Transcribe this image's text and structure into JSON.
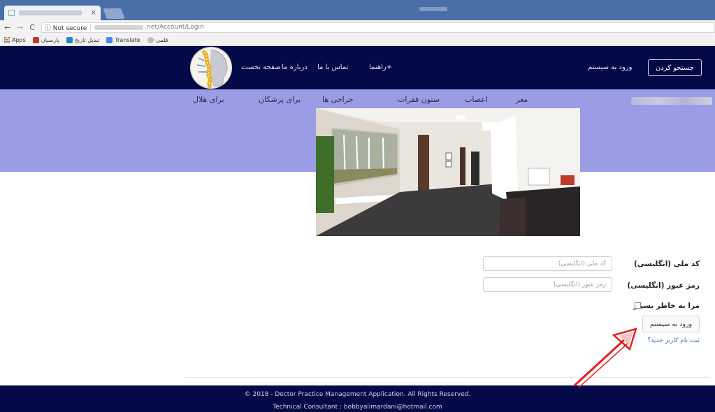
{
  "browser": {
    "tab_close": "×",
    "back_label": "←",
    "forward_label": "→",
    "reload_label": "C",
    "security_label": "ⓘ Not secure",
    "url_suffix": ".net/Account/Login",
    "bookmarks": [
      {
        "label": "Apps",
        "color": "#e0442f"
      },
      {
        "label": "پارسیان",
        "color": "#c0392b"
      },
      {
        "label": "تبدیل تاریخ",
        "color": "#1e88c8"
      },
      {
        "label": "Translate",
        "color": "#4a86e8"
      },
      {
        "label": "قلمی",
        "color": "#888888"
      }
    ]
  },
  "header": {
    "nav": {
      "home": "صفحه نخست",
      "about": "درباره ما",
      "contact": "تماس با ما",
      "help": "راهنما+"
    },
    "login_link": "ورود به سیستم",
    "search_button": "جستجو کردن",
    "bg_color": "#040a47"
  },
  "categories": {
    "brain": "مغز",
    "nerves": "اعصاب",
    "spine": "ستون فقرات",
    "surgery": "جراحی ها",
    "for_doctors": "برای پزشکان",
    "for_hilal": "برای هلال",
    "band_color": "#9b9ce6"
  },
  "form": {
    "national_code_label": "کد ملی (انگلیسی)",
    "national_code_placeholder": "کد ملی (انگلیسی)",
    "password_label": "رمز عبور (انگلیسی)",
    "password_placeholder": "رمز عبور (انگلیسی)",
    "remember_label": "مرا به خاطر بسپار",
    "submit_label": "ورود به سیستم",
    "register_link": "ثبت نام کاربر جدید؟"
  },
  "footer": {
    "copyright": "© 2018 - Doctor Practice Management Application. All Rights Reserved.",
    "consultant": "Technical Consultant : bobbyalimardani@hotmail.com"
  },
  "annotation_color": "#e02020"
}
